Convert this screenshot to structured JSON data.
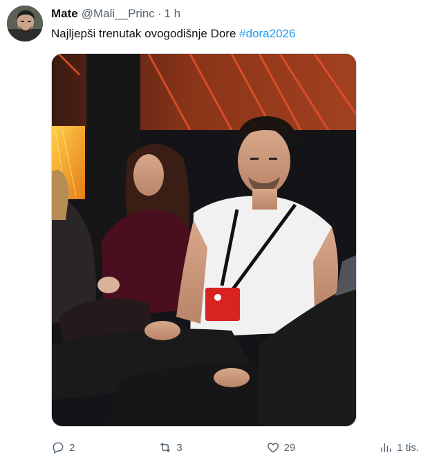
{
  "tweet": {
    "display_name": "Mate",
    "handle": "@Mali__Princ",
    "separator": "·",
    "time": "1 h",
    "text": "Najljepši trenutak ovogodišnje Dore ",
    "hashtag": "#dora2026"
  },
  "actions": {
    "reply_count": "2",
    "retweet_count": "3",
    "like_count": "29",
    "views_count": "1 tis."
  },
  "colors": {
    "text": "#0f1419",
    "secondary": "#536471",
    "link": "#1d9bf0",
    "border": "#cfd9de"
  }
}
